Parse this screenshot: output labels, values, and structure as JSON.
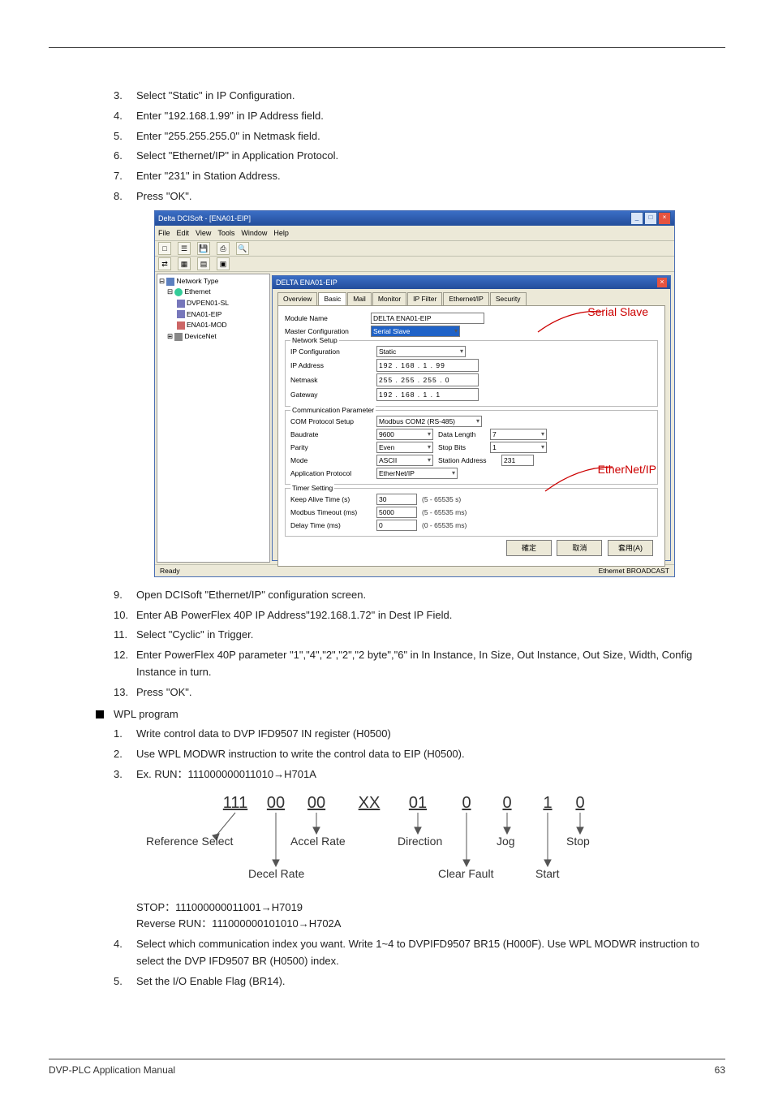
{
  "steps_a": [
    {
      "n": "3.",
      "t": "Select \"Static\" in IP Configuration."
    },
    {
      "n": "4.",
      "t": "Enter \"192.168.1.99\" in IP Address field."
    },
    {
      "n": "5.",
      "t": "Enter \"255.255.255.0\" in Netmask field."
    },
    {
      "n": "6.",
      "t": "Select \"Ethernet/IP\" in Application Protocol."
    },
    {
      "n": "7.",
      "t": "Enter \"231\" in Station Address."
    },
    {
      "n": "8.",
      "t": "Press \"OK\"."
    }
  ],
  "steps_b": [
    {
      "n": "9.",
      "t": "Open DCISoft \"Ethernet/IP\" configuration screen."
    },
    {
      "n": "10.",
      "t": "Enter AB PowerFlex 40P IP Address\"192.168.1.72\" in Dest IP Field."
    },
    {
      "n": "11.",
      "t": "Select \"Cyclic\" in Trigger."
    },
    {
      "n": "12.",
      "t": "Enter PowerFlex 40P parameter \"1\",\"4\",\"2\",\"2\",\"2 byte\",\"6\" in In Instance, In Size, Out Instance, Out Size, Width, Config Instance in turn."
    },
    {
      "n": "13.",
      "t": "Press \"OK\"."
    }
  ],
  "section_wpl": "WPL program",
  "steps_wpl": [
    {
      "n": "1.",
      "t": "Write control data to DVP IFD9507 IN register (H0500)"
    },
    {
      "n": "2.",
      "t": "Use WPL MODWR instruction to write the control data to EIP (H0500)."
    },
    {
      "n": "3.",
      "t": "Ex. RUN：111000000011010→H701A"
    }
  ],
  "post_diagram": [
    "STOP：111000000011001→H7019",
    "Reverse RUN：111000000101010→H702A"
  ],
  "steps_wpl2": [
    {
      "n": "4.",
      "t": "Select which communication index you want. Write 1~4 to DVPIFD9507 BR15 (H000F). Use WPL MODWR instruction to select the DVP IFD9507 BR (H0500) index."
    },
    {
      "n": "5.",
      "t": "Set the I/O Enable Flag (BR14)."
    }
  ],
  "screenshot": {
    "window_title": "Delta DCISoft - [ENA01-EIP]",
    "menu": [
      "File",
      "Edit",
      "View",
      "Tools",
      "Window",
      "Help"
    ],
    "tree": {
      "root": "Network Type",
      "eth": "Ethernet",
      "eth_children": [
        "DVPEN01-SL",
        "ENA01-EIP",
        "ENA01-MOD"
      ],
      "dn": "DeviceNet"
    },
    "dlg_title": "DELTA ENA01-EIP",
    "tabs": [
      "Overview",
      "Basic",
      "Mail",
      "Monitor",
      "IP Filter",
      "Ethernet/IP",
      "Security"
    ],
    "active_tab": 1,
    "module_name_lbl": "Module Name",
    "module_name_val": "DELTA ENA01-EIP",
    "master_cfg_lbl": "Master Configuration",
    "master_cfg_val": "Serial Slave",
    "net_group": "Network Setup",
    "ipcfg_lbl": "IP Configuration",
    "ipcfg_val": "Static",
    "ipaddr_lbl": "IP Address",
    "ipaddr_val": "192 . 168 .  1  . 99",
    "netmask_lbl": "Netmask",
    "netmask_val": "255 . 255 . 255 .  0",
    "gateway_lbl": "Gateway",
    "gateway_val": "192 . 168 .  1  .  1",
    "com_group": "Communication Parameter",
    "comps_lbl": "COM Protocol Setup",
    "comps_val": "Modbus COM2 (RS-485)",
    "baud_lbl": "Baudrate",
    "baud_val": "9600",
    "datalen_lbl": "Data Length",
    "datalen_val": "7",
    "parity_lbl": "Parity",
    "parity_val": "Even",
    "stop_lbl": "Stop Bits",
    "stop_val": "1",
    "mode_lbl": "Mode",
    "mode_val": "ASCII",
    "station_lbl": "Station Address",
    "station_val": "231",
    "appp_lbl": "Application Protocol",
    "appp_val": "EtherNet/IP",
    "timer_group": "Timer Setting",
    "keep_lbl": "Keep Alive Time (s)",
    "keep_val": "30",
    "keep_hint": "(5 - 65535 s)",
    "modto_lbl": "Modbus Timeout (ms)",
    "modto_val": "5000",
    "modto_hint": "(5 - 65535 ms)",
    "delay_lbl": "Delay Time (ms)",
    "delay_val": "0",
    "delay_hint": "(0 - 65535 ms)",
    "btns": [
      "確定",
      "取消",
      "套用(A)"
    ],
    "status_left": "Ready",
    "status_right": "Ethernet  BROADCAST",
    "annot1": "Serial Slave",
    "annot2": "EtherNet/IP"
  },
  "chart_data": {
    "type": "table",
    "bit_groups": [
      "111",
      "00",
      "00",
      "XX",
      "01",
      "0",
      "0",
      "1",
      "0"
    ],
    "labels_top": [
      "Reference Select",
      "Decel Rate",
      "Accel Rate",
      "",
      "Direction",
      "Clear Fault",
      "Jog",
      "Start",
      "Stop"
    ]
  },
  "footer": {
    "left": "DVP-PLC Application Manual",
    "right": "63"
  }
}
